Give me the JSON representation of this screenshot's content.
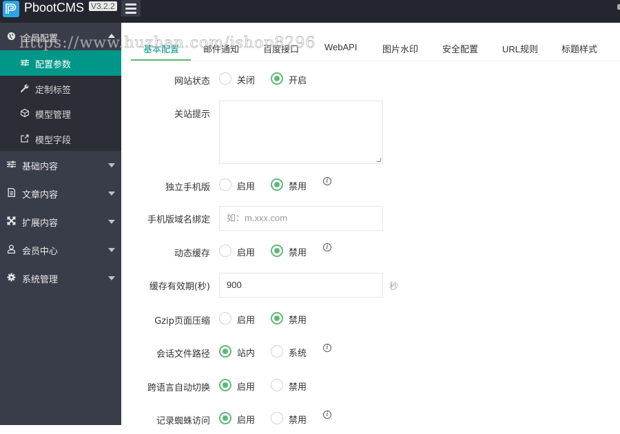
{
  "header": {
    "brand": "PbootCMS",
    "version": "V3.2.2",
    "logo_icon": "pboot-logo-icon",
    "menu_toggle_icon": "hamburger-icon"
  },
  "watermark": "https://www.huzhan.com/ishop8296",
  "sidebar": {
    "groups": [
      {
        "label": "全局配置",
        "icon": "globe-icon",
        "expanded": true,
        "items": [
          {
            "label": "配置参数",
            "icon": "sliders-icon",
            "active": true
          },
          {
            "label": "定制标签",
            "icon": "wrench-icon",
            "active": false
          },
          {
            "label": "模型管理",
            "icon": "cube-icon",
            "active": false
          },
          {
            "label": "模型字段",
            "icon": "external-link-icon",
            "active": false
          }
        ]
      },
      {
        "label": "基础内容",
        "icon": "sliders-icon",
        "expanded": false
      },
      {
        "label": "文章内容",
        "icon": "document-icon",
        "expanded": false
      },
      {
        "label": "扩展内容",
        "icon": "expand-icon",
        "expanded": false
      },
      {
        "label": "会员中心",
        "icon": "user-icon",
        "expanded": false
      },
      {
        "label": "系统管理",
        "icon": "gear-icon",
        "expanded": false
      }
    ]
  },
  "tabs": [
    {
      "label": "基本配置",
      "active": true
    },
    {
      "label": "邮件通知",
      "active": false
    },
    {
      "label": "百度接口",
      "active": false
    },
    {
      "label": "WebAPI",
      "active": false
    },
    {
      "label": "图片水印",
      "active": false
    },
    {
      "label": "安全配置",
      "active": false
    },
    {
      "label": "URL规则",
      "active": false
    },
    {
      "label": "标题样式",
      "active": false
    }
  ],
  "form": {
    "site_status": {
      "label": "网站状态",
      "options": [
        "关闭",
        "开启"
      ],
      "selected": "开启"
    },
    "close_notice": {
      "label": "关站提示",
      "value": ""
    },
    "mobile_site": {
      "label": "独立手机版",
      "options": [
        "启用",
        "禁用"
      ],
      "selected": "禁用",
      "has_info": true
    },
    "mobile_domain": {
      "label": "手机版域名绑定",
      "value": "",
      "placeholder": "如：m.xxx.com"
    },
    "dynamic_cache": {
      "label": "动态缓存",
      "options": [
        "启用",
        "禁用"
      ],
      "selected": "禁用",
      "has_info": true
    },
    "cache_ttl": {
      "label": "缓存有效期(秒)",
      "value": "900",
      "unit": "秒"
    },
    "gzip": {
      "label": "Gzip页面压缩",
      "options": [
        "启用",
        "禁用"
      ],
      "selected": "禁用"
    },
    "session_path": {
      "label": "会话文件路径",
      "options": [
        "站内",
        "系统"
      ],
      "selected": "站内",
      "has_info": true
    },
    "lang_switch": {
      "label": "跨语言自动切换",
      "options": [
        "启用",
        "禁用"
      ],
      "selected": "启用"
    },
    "spider_log": {
      "label": "记录蜘蛛访问",
      "options": [
        "启用",
        "禁用"
      ],
      "selected": "启用",
      "has_info": true
    }
  },
  "colors": {
    "topbar": "#23262e",
    "sidebar": "#393d49",
    "sidebar_sub": "#2b2e37",
    "active_item": "#009688",
    "radio_checked": "#5fb878",
    "logo": "#2ea3e4"
  }
}
